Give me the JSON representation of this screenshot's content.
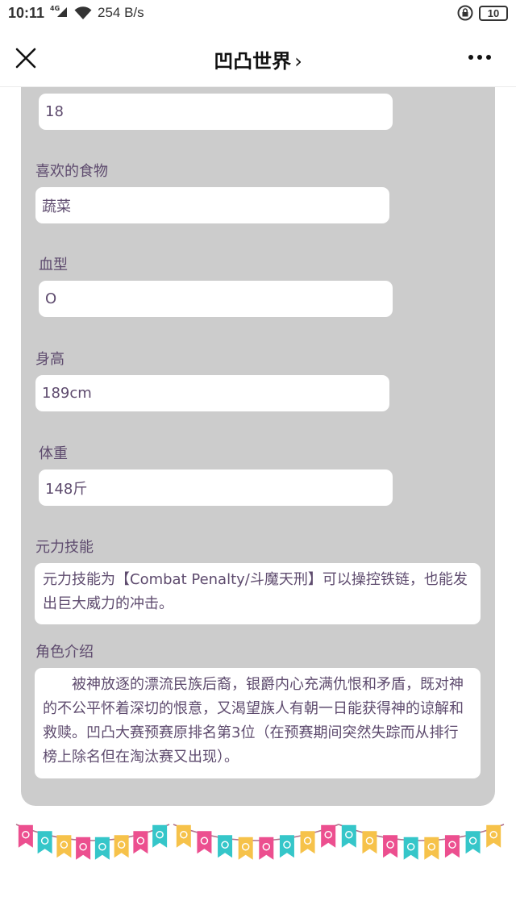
{
  "status": {
    "time": "10:11",
    "network": "4G",
    "speed": "254 B/s",
    "battery": "10"
  },
  "nav": {
    "title": "凹凸世界",
    "chevron": "›"
  },
  "profile": {
    "age_value": "18",
    "food_label": "喜欢的食物",
    "food_value": "蔬菜",
    "blood_label": "血型",
    "blood_value": "O",
    "height_label": "身高",
    "height_value": "189cm",
    "weight_label": "体重",
    "weight_value": "148斤",
    "skill_label": "元力技能",
    "skill_value": "元力技能为【Combat Penalty/斗魔天刑】可以操控铁链，也能发出巨大威力的冲击。",
    "intro_label": "角色介绍",
    "intro_value": "被神放逐的漂流民族后裔，银爵内心充满仇恨和矛盾，既对神的不公平怀着深切的恨意，又渴望族人有朝一日能获得神的谅解和救赎。凹凸大赛预赛原排名第3位（在预赛期间突然失踪而从排行榜上除名但在淘汰赛又出现）。"
  },
  "icons": {
    "close": "close-icon",
    "more": "more-icon",
    "wifi": "wifi-icon",
    "lock": "rotation-lock-icon",
    "battery": "battery-icon",
    "signal": "signal-icon"
  },
  "colors": {
    "card": "#cccccc",
    "text": "#5e4b6e",
    "flag_pink": "#ec4f8f",
    "flag_teal": "#35c6c9",
    "flag_yellow": "#f6c24a"
  }
}
